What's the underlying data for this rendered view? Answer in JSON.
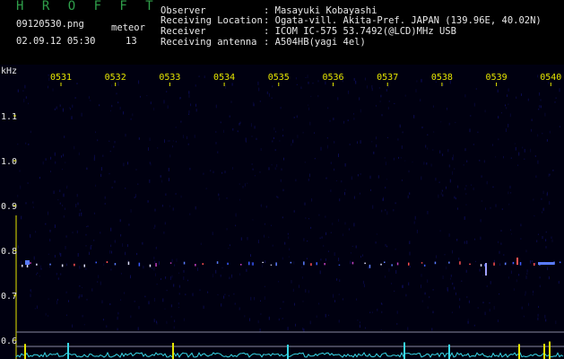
{
  "app": {
    "title": "H R O F F T",
    "filename": "09120530.png",
    "datetime": "02.09.12 05:30",
    "meteor_label": "meteor",
    "meteor_count": "13"
  },
  "info": {
    "observer_label": "Observer",
    "observer_value": ": Masayuki Kobayashi",
    "location_label": "Receiving Location",
    "location_value": ": Ogata-vill. Akita-Pref. JAPAN (139.96E, 40.02N)",
    "receiver_label": "Receiver",
    "receiver_value": ": ICOM IC-575 53.7492(@LCD)MHz USB",
    "antenna_label": "Receiving antenna",
    "antenna_value": ": A504HB(yagi 4el)"
  },
  "plot": {
    "unit_label": "kHz",
    "time_ticks": [
      "0531",
      "0532",
      "0533",
      "0534",
      "0535",
      "0536",
      "0537",
      "0538",
      "0539",
      "0540"
    ],
    "freq_ticks": [
      "1.1",
      "1.0",
      "0.9",
      "0.8",
      "0.7",
      "0.6"
    ],
    "colors": {
      "background": "#000010",
      "noise": "#10106a",
      "axis": "#e6e600",
      "label": "#e8e8e8",
      "baseline": "#8a8aa0",
      "trace": "#38d8e8"
    }
  }
}
